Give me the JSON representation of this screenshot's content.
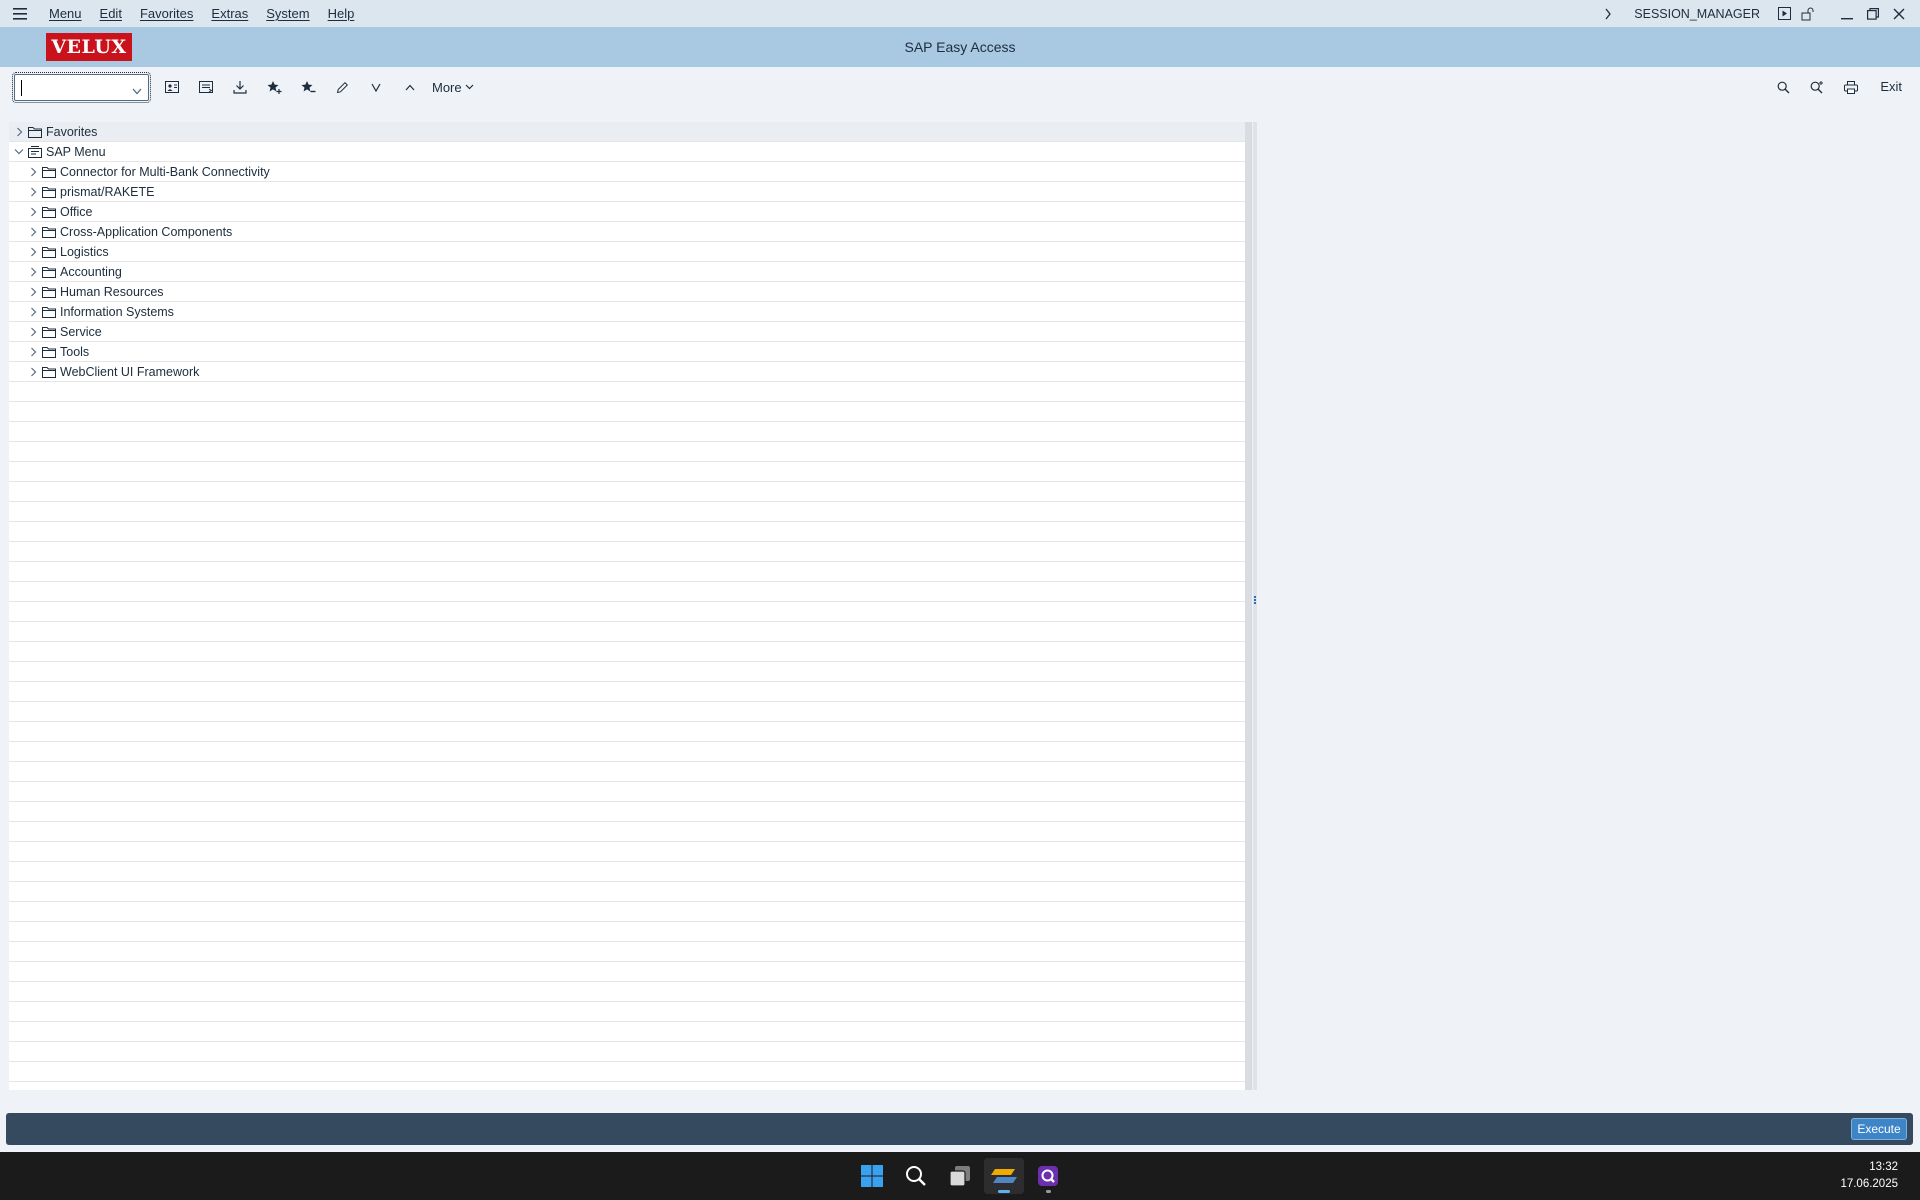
{
  "menubar": {
    "items": [
      "Menu",
      "Edit",
      "Favorites",
      "Extras",
      "System",
      "Help"
    ],
    "session": "SESSION_MANAGER"
  },
  "titlebar": {
    "logo": "VELUX",
    "title": "SAP Easy Access"
  },
  "toolbar": {
    "command_value": "",
    "icons": [
      "user-menu-icon",
      "sap-menu-icon",
      "download-icon",
      "add-favorite-icon",
      "delete-favorite-icon",
      "edit-icon",
      "move-down-icon",
      "move-up-icon"
    ],
    "more_label": "More",
    "right_icons": [
      "find-icon",
      "find-next-icon",
      "print-icon"
    ],
    "exit_label": "Exit"
  },
  "tree": {
    "favorites": "Favorites",
    "sap_menu": "SAP Menu",
    "children": [
      "Connector for Multi-Bank Connectivity",
      "prismat/RAKETE",
      "Office",
      "Cross-Application Components",
      "Logistics",
      "Accounting",
      "Human Resources",
      "Information Systems",
      "Service",
      "Tools",
      "WebClient UI Framework"
    ]
  },
  "footer": {
    "execute_label": "Execute"
  },
  "taskbar": {
    "apps": [
      "windows-start-icon",
      "search-icon",
      "task-view-icon",
      "sap-gui-icon",
      "sap-logon-icon"
    ],
    "time": "13:32",
    "date": "17.06.2025"
  },
  "colors": {
    "menubar_bg": "#dbe6ef",
    "titlebar_bg": "#a9c8e2",
    "logo_red": "#c9121b",
    "footer_bg": "#354a5f",
    "execute_blue": "#3d85c6"
  }
}
